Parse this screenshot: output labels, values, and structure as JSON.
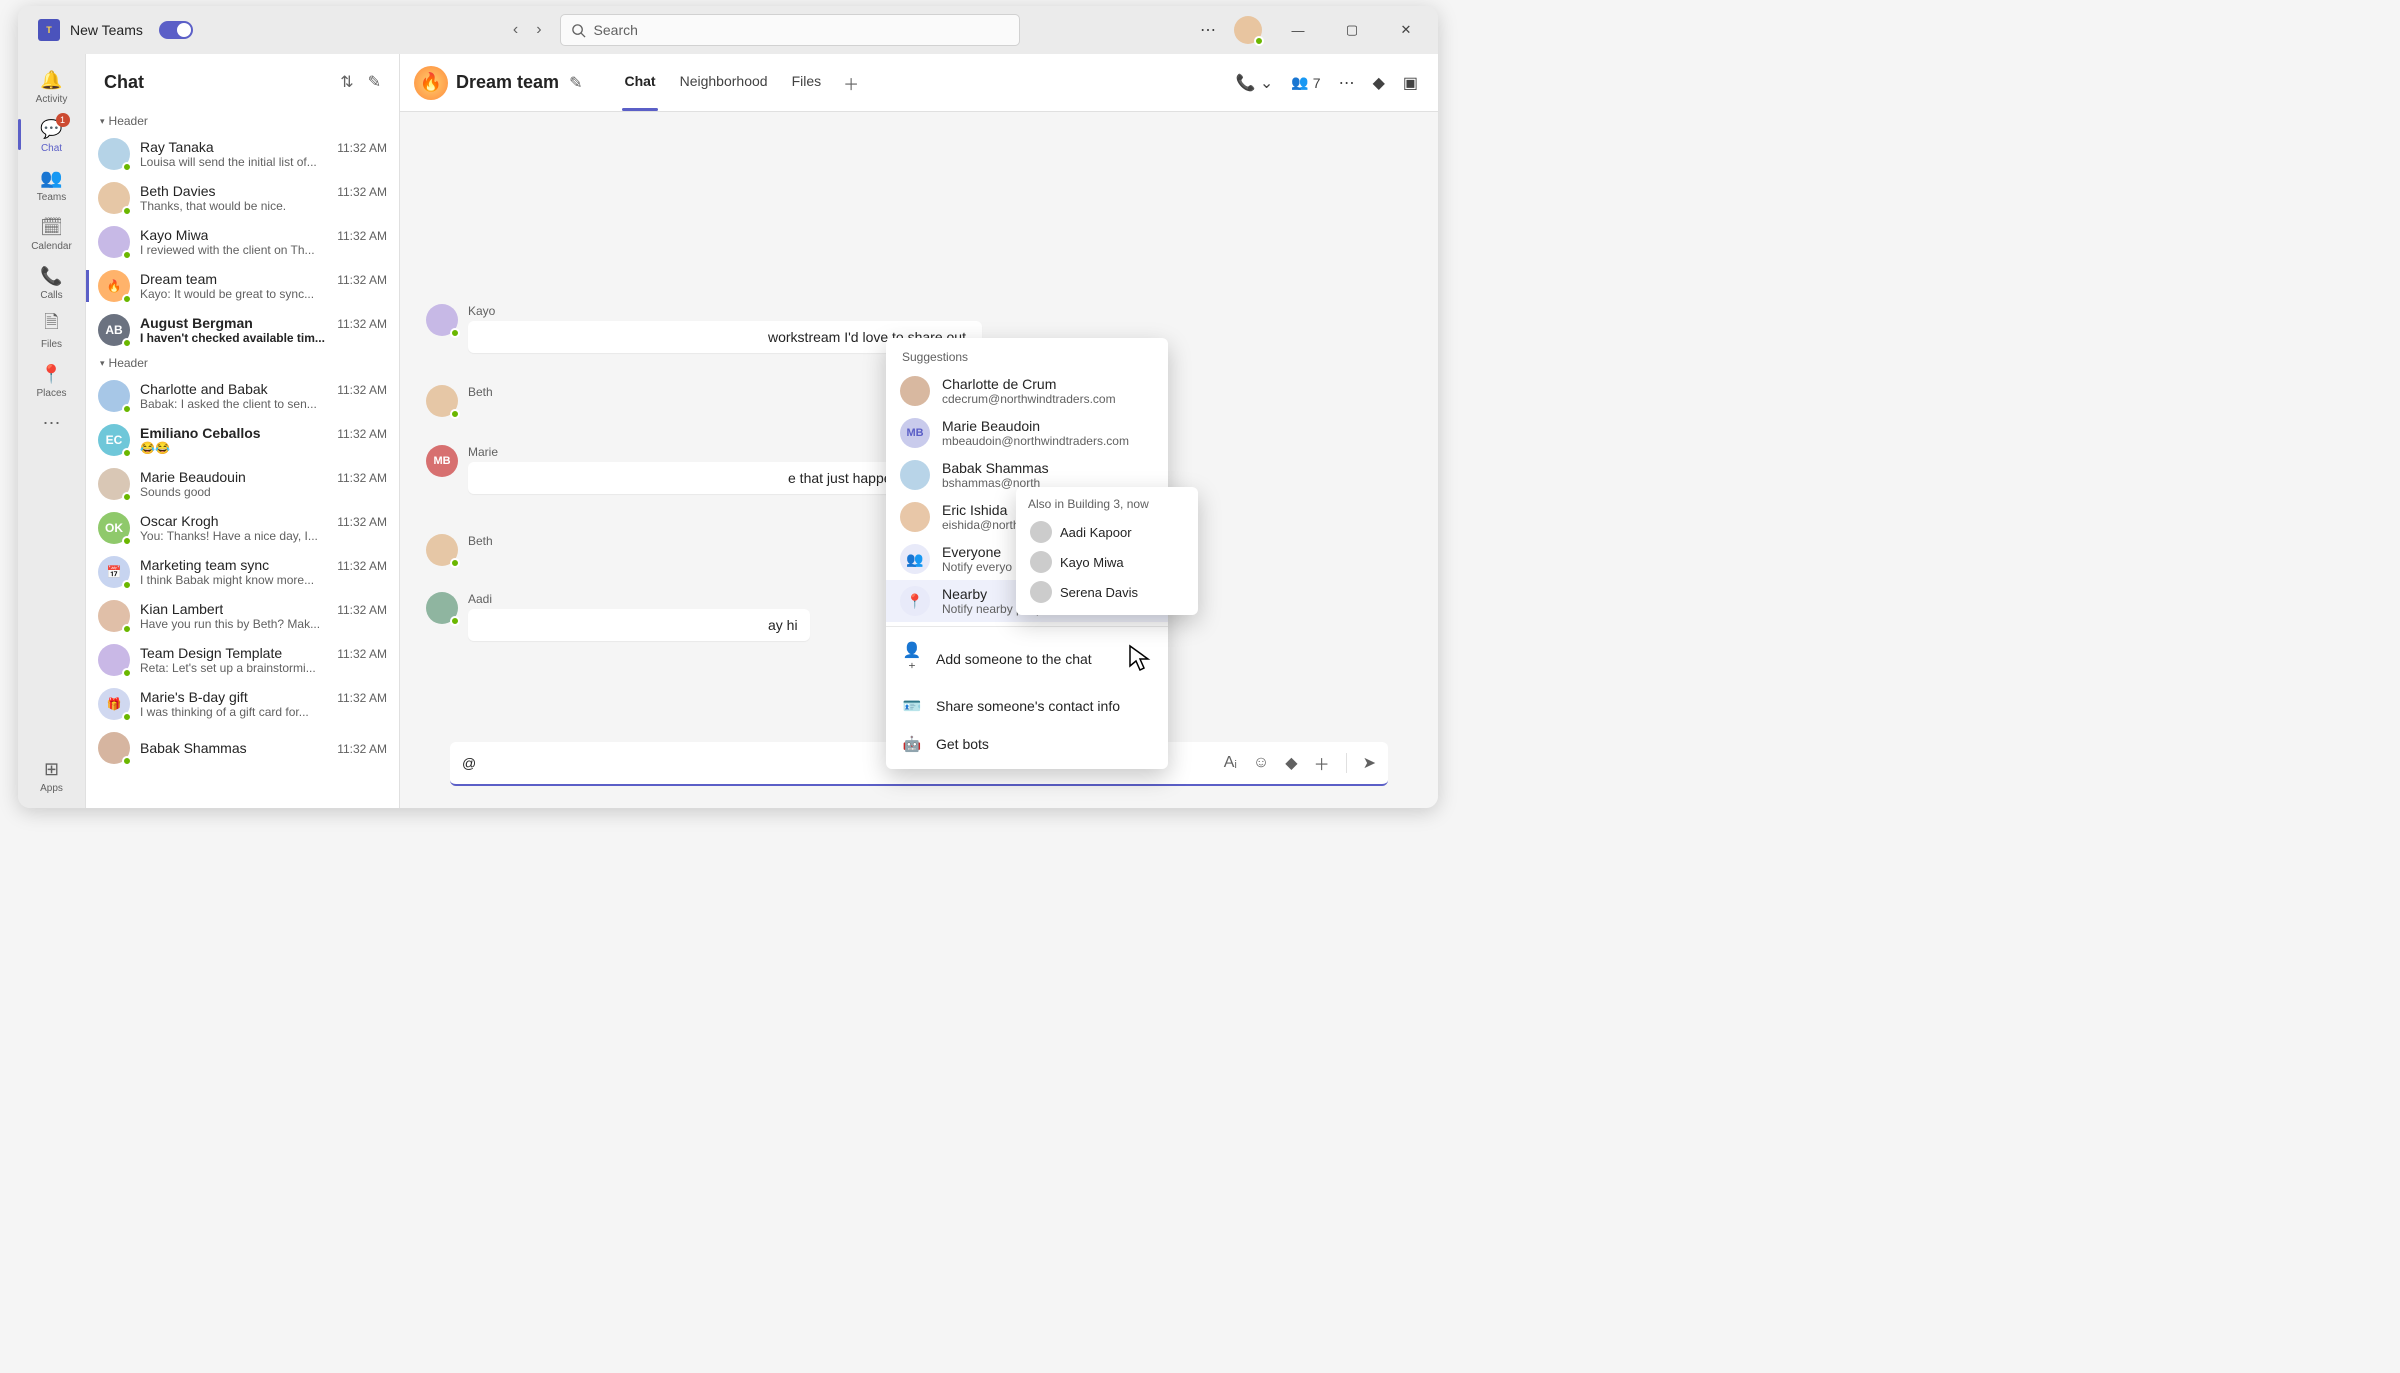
{
  "title": "New Teams",
  "search_placeholder": "Search",
  "rail": [
    {
      "label": "Activity",
      "icon": "bell"
    },
    {
      "label": "Chat",
      "icon": "chat",
      "active": true,
      "badge": "1"
    },
    {
      "label": "Teams",
      "icon": "people"
    },
    {
      "label": "Calendar",
      "icon": "calendar"
    },
    {
      "label": "Calls",
      "icon": "phone"
    },
    {
      "label": "Files",
      "icon": "file"
    },
    {
      "label": "Places",
      "icon": "pin"
    }
  ],
  "rail_apps_label": "Apps",
  "chat_panel": {
    "title": "Chat",
    "sections": [
      {
        "label": "Header",
        "items_idx": [
          0,
          1,
          2,
          3,
          4
        ]
      },
      {
        "label": "Header",
        "items_idx": [
          5,
          6,
          7,
          8,
          9,
          10,
          11,
          12,
          13
        ]
      }
    ],
    "items": [
      {
        "name": "Ray Tanaka",
        "preview": "Louisa will send the initial list of...",
        "time": "11:32 AM",
        "avatar_bg": "#b5d3e7"
      },
      {
        "name": "Beth Davies",
        "preview": "Thanks, that would be nice.",
        "time": "11:32 AM",
        "avatar_bg": "#e6c7a6"
      },
      {
        "name": "Kayo Miwa",
        "preview": "I reviewed with the client on Th...",
        "time": "11:32 AM",
        "avatar_bg": "#c7b9e6"
      },
      {
        "name": "Dream team",
        "preview": "Kayo: It would be great to sync...",
        "time": "11:32 AM",
        "selected": true,
        "avatar_bg": "#ffb36b",
        "emoji": "🔥"
      },
      {
        "name": "August Bergman",
        "preview": "I haven't checked available tim...",
        "time": "11:32 AM",
        "unread": true,
        "initials": "AB",
        "avatar_bg": "#6b7280"
      },
      {
        "name": "Charlotte and Babak",
        "preview": "Babak: I asked the client to sen...",
        "time": "11:32 AM",
        "avatar_bg": "#a7c7e7"
      },
      {
        "name": "Emiliano Ceballos",
        "preview": "😂😂",
        "time": "11:32 AM",
        "unread": true,
        "initials": "EC",
        "avatar_bg": "#6fc7d9"
      },
      {
        "name": "Marie Beaudouin",
        "preview": "Sounds good",
        "time": "11:32 AM",
        "avatar_bg": "#d9c7b5"
      },
      {
        "name": "Oscar Krogh",
        "preview": "You: Thanks! Have a nice day, I...",
        "time": "11:32 AM",
        "initials": "OK",
        "avatar_bg": "#8fc96b"
      },
      {
        "name": "Marketing team sync",
        "preview": "I think Babak might know more...",
        "time": "11:32 AM",
        "avatar_bg": "#c7d4f0",
        "emoji": "📅"
      },
      {
        "name": "Kian Lambert",
        "preview": "Have you run this by Beth? Mak...",
        "time": "11:32 AM",
        "avatar_bg": "#e0bfa8"
      },
      {
        "name": "Team Design Template",
        "preview": "Reta: Let's set up a brainstormi...",
        "time": "11:32 AM",
        "avatar_bg": "#c9b8e6"
      },
      {
        "name": "Marie's B-day gift",
        "preview": "I was thinking of a gift card for...",
        "time": "11:32 AM",
        "avatar_bg": "#d0d8f0",
        "emoji": "🎁"
      },
      {
        "name": "Babak Shammas",
        "preview": "",
        "time": "11:32 AM",
        "avatar_bg": "#d6b5a0"
      }
    ]
  },
  "conversation": {
    "title": "Dream team",
    "emoji": "🔥",
    "tabs": [
      {
        "label": "Chat",
        "active": true
      },
      {
        "label": "Neighborhood"
      },
      {
        "label": "Files"
      }
    ],
    "participant_count": "7",
    "messages": [
      {
        "sender": "Kayo",
        "avatar_bg": "#c7b9e6",
        "text": "workstream I'd love to share out.",
        "trailing": true
      },
      {
        "sender": "Beth",
        "avatar_bg": "#e6c7a6",
        "text": ""
      },
      {
        "sender": "Marie",
        "initials": "MB",
        "avatar_bg": "#d77070",
        "text": "e that just happened! Haha I love",
        "trailing": true
      },
      {
        "sender": "Beth",
        "avatar_bg": "#e6c7a6",
        "text": ""
      },
      {
        "sender": "Aadi",
        "avatar_bg": "#8fb5a0",
        "text": "ay hi",
        "trailing": true
      }
    ]
  },
  "compose": {
    "value": "@"
  },
  "suggestions": {
    "header": "Suggestions",
    "people": [
      {
        "name": "Charlotte de Crum",
        "detail": "cdecrum@northwindtraders.com",
        "avatar_bg": "#d8b8a0"
      },
      {
        "name": "Marie Beaudoin",
        "detail": "mbeaudoin@northwindtraders.com",
        "initials": "MB",
        "avatar_bg": "#c9cbec"
      },
      {
        "name": "Babak Shammas",
        "detail": "bshammas@north",
        "avatar_bg": "#b8d4e8"
      },
      {
        "name": "Eric Ishida",
        "detail": "eishida@north",
        "avatar_bg": "#e8c7a8"
      },
      {
        "name": "Everyone",
        "detail": "Notify everyo",
        "iconic": true,
        "glyph": "👥"
      },
      {
        "name": "Nearby",
        "detail": "Notify nearby people in the chat",
        "iconic": true,
        "glyph": "📍",
        "selected": true
      }
    ],
    "actions": [
      {
        "label": "Add someone to the chat",
        "icon": "person-add"
      },
      {
        "label": "Share someone's contact info",
        "icon": "contact-card"
      },
      {
        "label": "Get bots",
        "icon": "bot"
      }
    ]
  },
  "nearby_flyout": {
    "title": "Also in Building 3, now",
    "people": [
      {
        "name": "Aadi Kapoor"
      },
      {
        "name": "Kayo Miwa"
      },
      {
        "name": "Serena Davis"
      }
    ]
  }
}
